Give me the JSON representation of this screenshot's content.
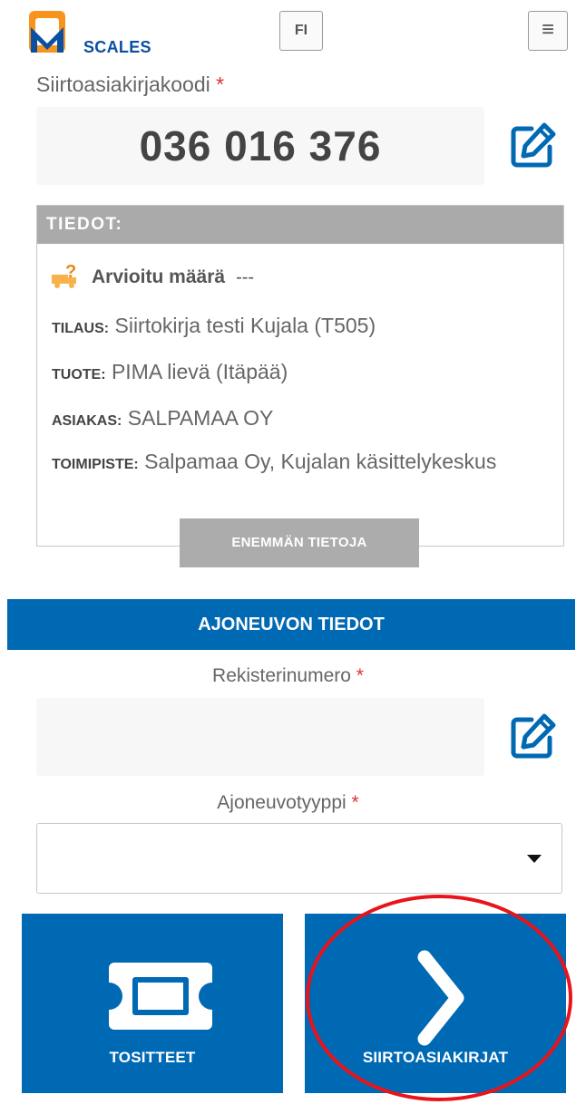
{
  "header": {
    "logo_text": "SCALES",
    "language_button": "FI",
    "menu_icon": "hamburger-menu-icon"
  },
  "transfer_doc": {
    "label": "Siirtoasiakirjakoodi",
    "required_mark": "*",
    "code": "036 016 376",
    "edit_icon": "edit-pencil-icon"
  },
  "info": {
    "heading": "TIEDOT:",
    "estimated_label": "Arvioitu määrä",
    "estimated_value": "---",
    "order_key": "TILAUS:",
    "order_value": "Siirtokirja testi Kujala (T505)",
    "product_key": "TUOTE:",
    "product_value": "PIMA lievä (Itäpää)",
    "customer_key": "ASIAKAS:",
    "customer_value": "SALPAMAA OY",
    "site_key": "TOIMIPISTE:",
    "site_value": "Salpamaa Oy, Kujalan käsittelykeskus",
    "more_button": "ENEMMÄN TIETOJA"
  },
  "vehicle": {
    "section_title": "AJONEUVON TIEDOT",
    "reg_label": "Rekisterinumero",
    "reg_value": "",
    "type_label": "Ajoneuvotyyppi",
    "type_value": "",
    "required_mark": "*"
  },
  "actions": {
    "receipts_label": "TOSITTEET",
    "receipts_icon": "ticket-icon",
    "transfer_docs_label": "SIIRTOASIAKIRJAT",
    "transfer_docs_icon": "chevron-right-icon"
  },
  "colors": {
    "primary_blue": "#0069b4",
    "logo_orange": "#f7941d",
    "required_red": "#e03131",
    "panel_grey": "#aaaaaa",
    "annotation_red": "#e8141b"
  }
}
